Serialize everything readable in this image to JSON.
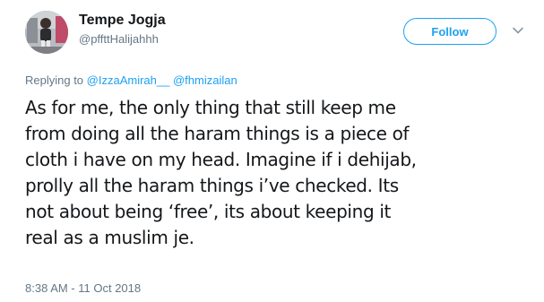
{
  "user": {
    "display_name": "Tempe Jogja",
    "handle": "@pffttHalijahhh",
    "avatar_icon": "user-photo-avatar"
  },
  "follow": {
    "label": "Follow",
    "accent_color": "#1da1f2"
  },
  "menu": {
    "icon": "chevron-down-icon"
  },
  "reply": {
    "prefix": "Replying to",
    "mentions": [
      "@IzzaAmirah__",
      "@fhmizailan"
    ]
  },
  "tweet": {
    "lines": [
      "As for me, the only thing that still keep me",
      "from doing all the haram things is a piece of",
      "cloth i have on my head. Imagine if i dehijab,",
      "prolly all the haram things i’ve checked. Its",
      "not about being ‘free’, its about keeping it",
      "real as a muslim je."
    ]
  },
  "timestamp": "8:38 AM - 11 Oct 2018"
}
